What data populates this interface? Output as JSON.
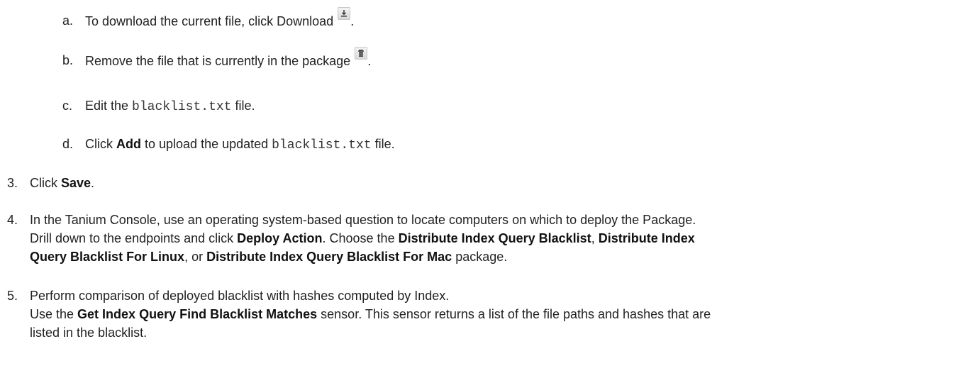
{
  "substeps": {
    "a": {
      "marker": "a.",
      "text_before": "To download the current file, click Download",
      "icon": "download-icon",
      "text_after": "."
    },
    "b": {
      "marker": "b.",
      "text_before": "Remove the file that is currently in the package",
      "icon": "trash-icon",
      "text_after": "."
    },
    "c": {
      "marker": "c.",
      "text_before": "Edit the ",
      "code": "blacklist.txt",
      "text_after": " file."
    },
    "d": {
      "marker": "d.",
      "text_before": "Click ",
      "bold": "Add",
      "text_middle": " to upload the updated ",
      "code": "blacklist.txt",
      "text_after": " file."
    }
  },
  "steps": {
    "s3": {
      "marker": "3.",
      "text_before": "Click ",
      "bold": "Save",
      "text_after": "."
    },
    "s4": {
      "marker": "4.",
      "line1": "In the Tanium Console, use an operating system-based question to locate computers on which to deploy the Package.",
      "line2_before": "Drill down to the endpoints and click ",
      "bold_deploy": "Deploy Action",
      "line2_mid": ". Choose the ",
      "bold_pkg1": "Distribute Index Query Blacklist",
      "line2_comma": ", ",
      "bold_pkg2a": "Distribute Index",
      "bold_pkg2b": "Query Blacklist For Linux",
      "line3_or": ", or ",
      "bold_pkg3": "Distribute Index Query Blacklist For Mac",
      "line3_after": " package."
    },
    "s5": {
      "marker": "5.",
      "line1": "Perform comparison of deployed blacklist with hashes computed by Index.",
      "line2_before": "Use the ",
      "bold_sensor": "Get Index Query Find Blacklist Matches",
      "line2_after": " sensor. This sensor returns a list of the file paths and hashes that are",
      "line3": "listed in the blacklist."
    }
  }
}
